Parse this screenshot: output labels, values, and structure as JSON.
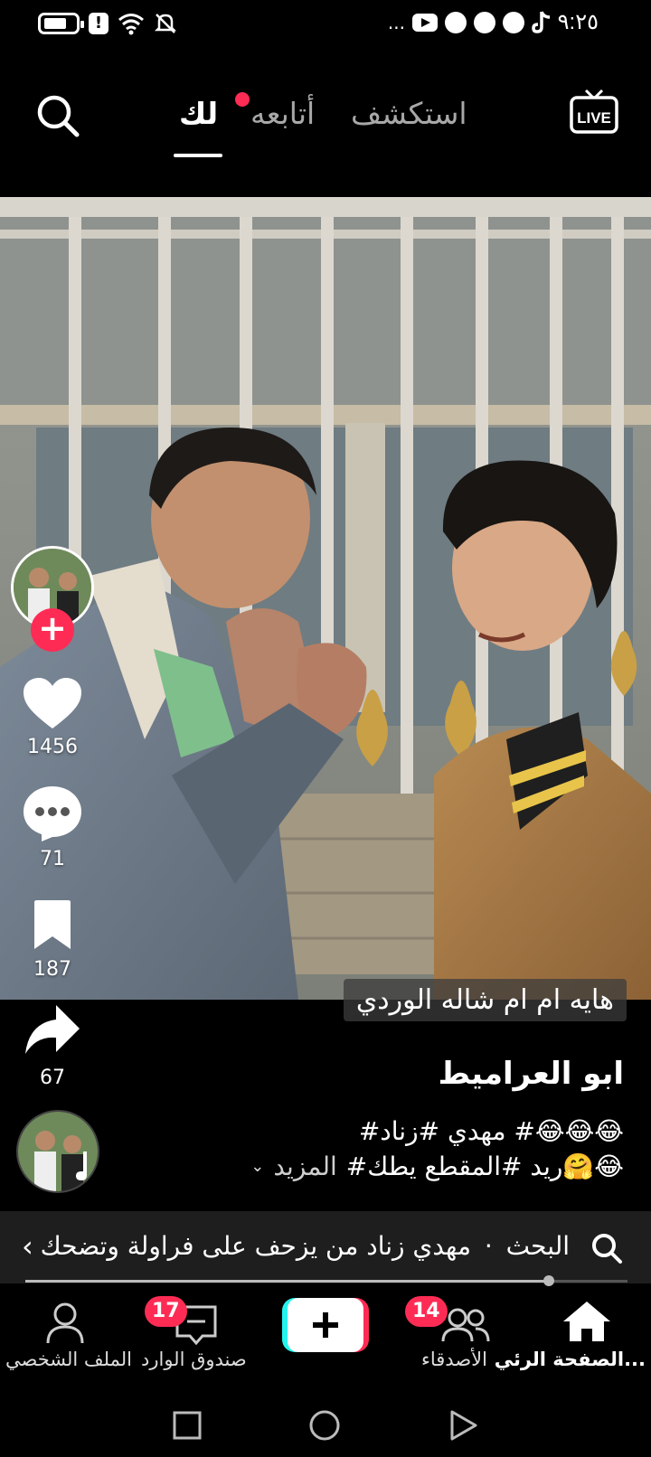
{
  "status_bar": {
    "time": "٩:٢٥",
    "ellipsis": "..."
  },
  "top_nav": {
    "live_label": "LIVE",
    "explore_label": "استكشف",
    "following_label": "أتابعه",
    "foryou_label": "لك"
  },
  "actions": {
    "likes": "1456",
    "comments": "71",
    "saves": "187",
    "shares": "67"
  },
  "video": {
    "overlay_text": "هايه ام ام شاله الوردي",
    "username": "ابو العراميط",
    "desc_line1": "#مهدي #زناد #😂😂😂",
    "desc_line2": "#ريد #المقطع يطك🤗😂",
    "more_label": "المزيد"
  },
  "search_suggestion": {
    "prefix": "البحث",
    "separator": "·",
    "query": "مهدي زناد من يزحف على فراولة وتضحك",
    "progress": 0.87
  },
  "bottom_nav": {
    "home_label": "الصفحة الرئي...",
    "friends_label": "الأصدقاء",
    "friends_badge": "14",
    "inbox_label": "صندوق الوارد",
    "inbox_badge": "17",
    "profile_label": "الملف الشخصي"
  },
  "colors": {
    "accent": "#fe2c55",
    "cyan": "#25f4ee"
  }
}
